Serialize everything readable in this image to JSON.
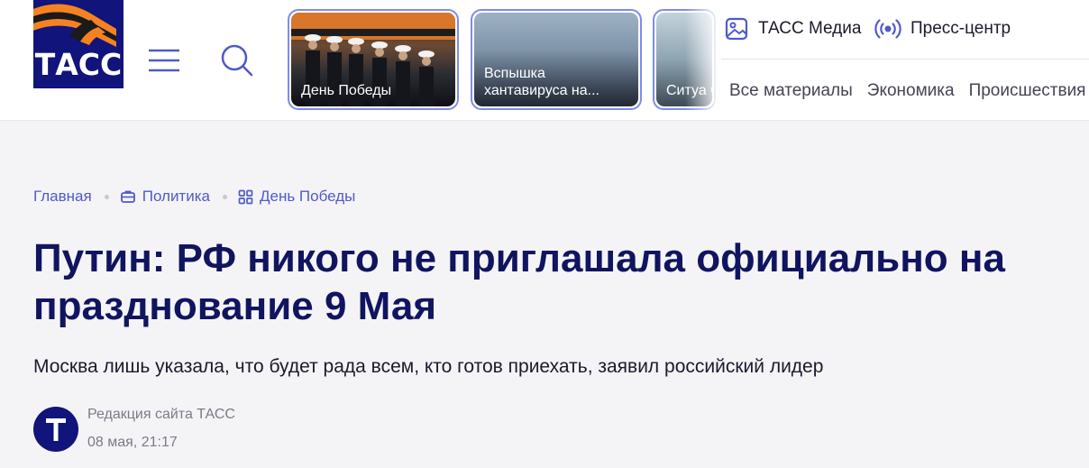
{
  "header": {
    "logo_text": "ТАСС",
    "stories": [
      {
        "label": "День Победы"
      },
      {
        "label": "Вспышка хантавируса на..."
      },
      {
        "label": "Ситуа Ормуз"
      }
    ],
    "top_links": {
      "media": "ТАСС Медиа",
      "press": "Пресс-центр"
    },
    "nav": [
      "Все материалы",
      "Экономика",
      "Происшествия"
    ]
  },
  "article": {
    "breadcrumbs": [
      "Главная",
      "Политика",
      "День Победы"
    ],
    "title": "Путин: РФ никого не приглашала официально на празднование 9 Мая",
    "lead": "Москва лишь указала, что будет рада всем, кто готов приехать, заявил российский лидер",
    "author": "Редакция сайта ТАСС",
    "date": "08 мая, 21:17"
  },
  "colors": {
    "brand": "#11147a",
    "title": "#11145f",
    "link": "#4f5ac8",
    "ribbon_orange": "#f58220",
    "ribbon_black": "#1a1a1a"
  },
  "icons": [
    "tass-logo",
    "hamburger-icon",
    "search-icon",
    "image-icon",
    "broadcast-icon",
    "briefcase-icon",
    "grid-icon",
    "t-avatar-icon"
  ]
}
